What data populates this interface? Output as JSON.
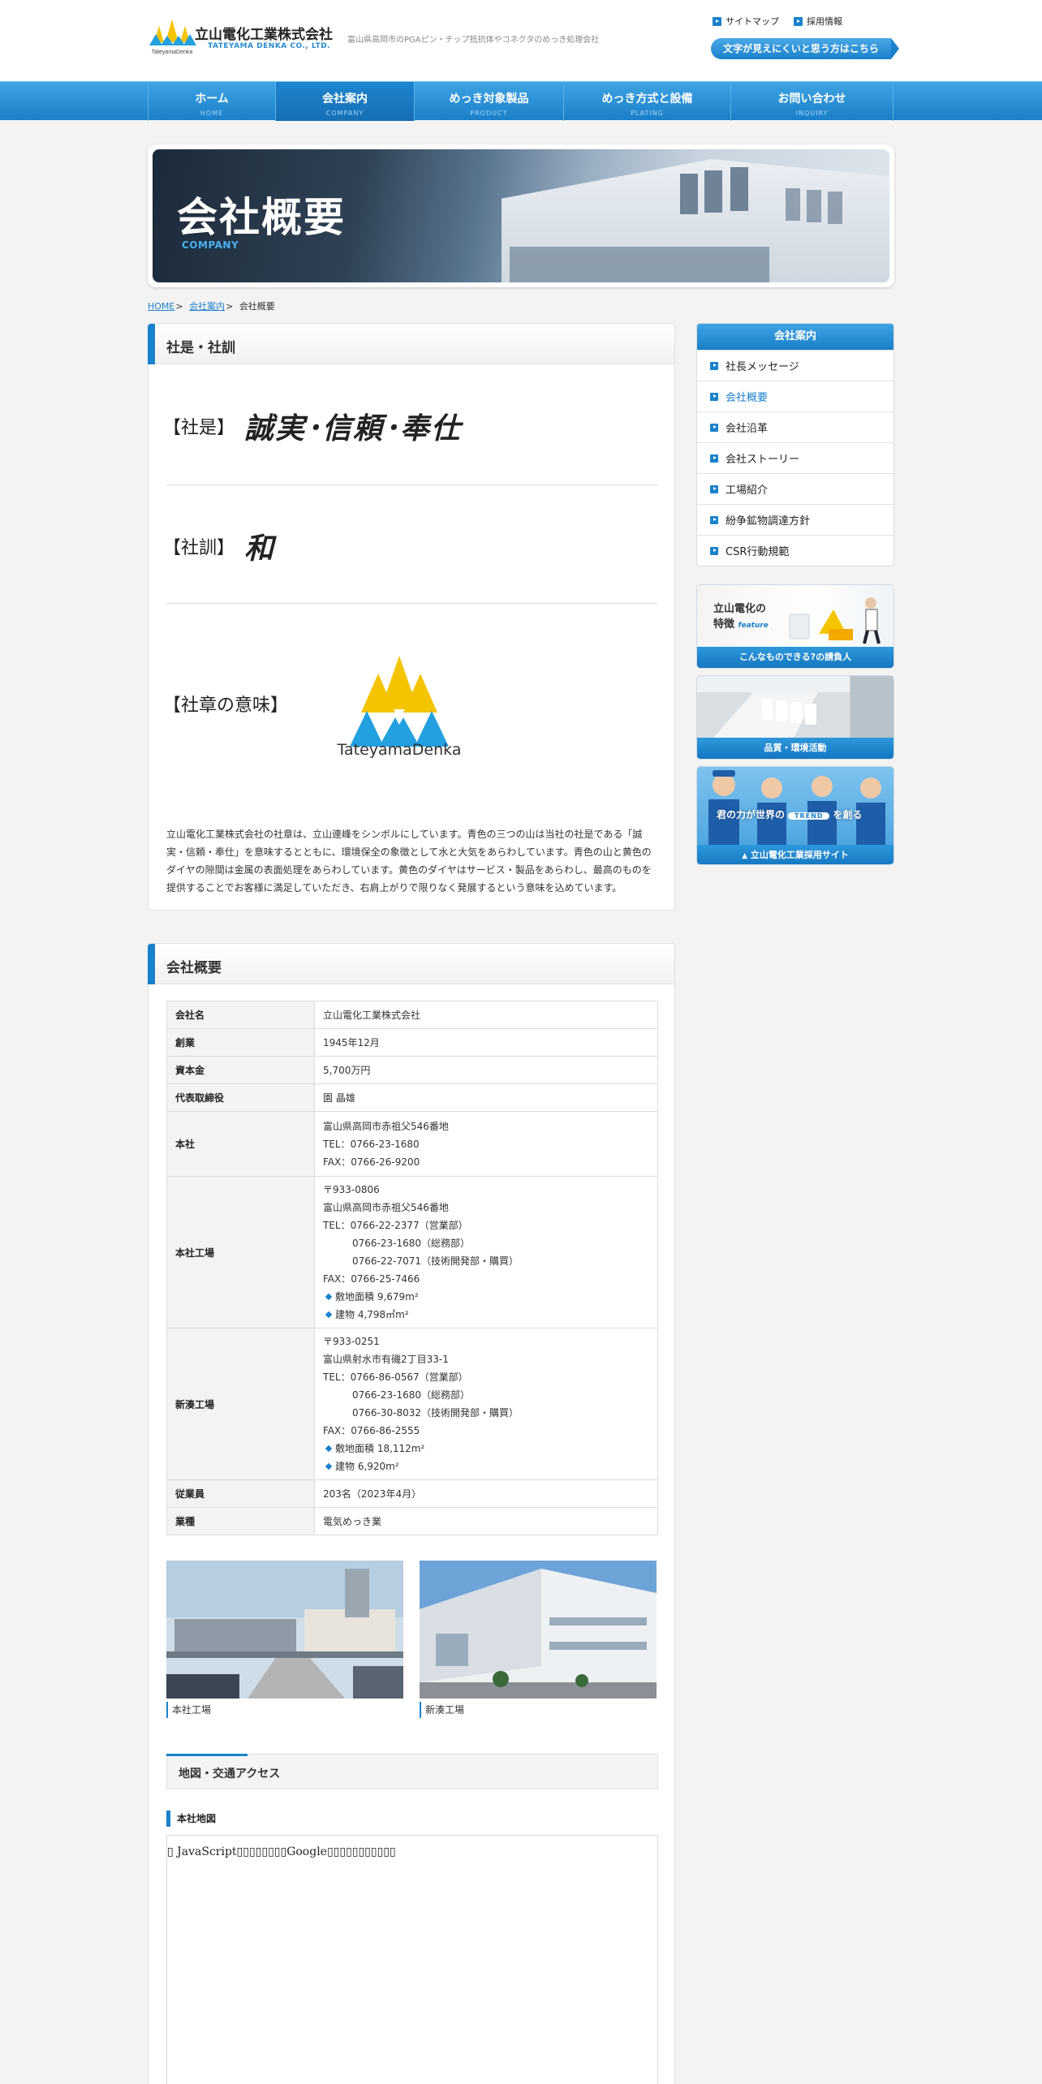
{
  "header": {
    "company_name": "立山電化工業株式会社",
    "company_name_en": "TATEYAMA DENKA CO., LTD.",
    "logo_text": "TateyamaDenka",
    "tagline": "富山県高岡市のPGAピン・チップ抵抗体やコネクタのめっき処理会社",
    "sitemap_label": "サイトマップ",
    "recruit_label": "採用情報",
    "access_label": "文字が見えにくいと思う方はこちら"
  },
  "nav": {
    "items": [
      {
        "jp": "ホーム",
        "en": "HOME"
      },
      {
        "jp": "会社案内",
        "en": "COMPANY"
      },
      {
        "jp": "めっき対象製品",
        "en": "PRODUCT"
      },
      {
        "jp": "めっき方式と設備",
        "en": "PLATING"
      },
      {
        "jp": "お問い合わせ",
        "en": "INQUIRY"
      }
    ]
  },
  "hero": {
    "title": "会社概要",
    "subtitle": "COMPANY"
  },
  "breadcrumb": {
    "home": "HOME",
    "company": "会社案内",
    "current": "会社概要"
  },
  "motto": {
    "heading": "社是・社訓",
    "shaze_label": "【社是】",
    "shaze_value": "誠実･信頼･奉仕",
    "shakun_label": "【社訓】",
    "shakun_value": "和",
    "emblem_label": "【社章の意味】",
    "emblem_caption": "TateyamaDenka",
    "description": "立山電化工業株式会社の社章は、立山連峰をシンボルにしています。青色の三つの山は当社の社是である「誠実・信頼・奉仕」を意味するとともに、環境保全の象徴として水と大気をあらわしています。青色の山と黄色のダイヤの隙間は金属の表面処理をあらわしています。黄色のダイヤはサービス・製品をあらわし、最高のものを提供することでお客様に満足していただき、右肩上がりで限りなく発展するという意味を込めています。"
  },
  "overview": {
    "heading": "会社概要",
    "rows": {
      "name": {
        "label": "会社名",
        "value": "立山電化工業株式会社"
      },
      "founded": {
        "label": "創業",
        "value": "1945年12月"
      },
      "capital": {
        "label": "資本金",
        "value": "5,700万円"
      },
      "ceo": {
        "label": "代表取締役",
        "value": "園 晶雄"
      },
      "hq": {
        "label": "本社",
        "address": "富山県高岡市赤祖父546番地",
        "tel": "TEL：0766-23-1680",
        "fax": "FAX：0766-26-9200"
      },
      "honsha_factory": {
        "label": "本社工場",
        "zip": "〒933-0806",
        "address": "富山県高岡市赤祖父546番地",
        "tel1": "TEL：0766-22-2377（営業部）",
        "tel2": "0766-23-1680（総務部）",
        "tel3": "0766-22-7071（技術開発部・購買）",
        "fax": "FAX：0766-25-7466",
        "site_area": "敷地面積 9,679m²",
        "building": "建物 4,798㎡m²"
      },
      "shinminato_factory": {
        "label": "新湊工場",
        "zip": "〒933-0251",
        "address": "富山県射水市有磯2丁目33-1",
        "tel1": "TEL：0766-86-0567（営業部）",
        "tel2": "0766-23-1680（総務部）",
        "tel3": "0766-30-8032（技術開発部・購買）",
        "fax": "FAX：0766-86-2555",
        "site_area": "敷地面積 18,112m²",
        "building": "建物 6,920m²"
      },
      "employees": {
        "label": "従業員",
        "value": "203名（2023年4月）"
      },
      "business": {
        "label": "業種",
        "value": "電気めっき業"
      }
    },
    "photo1_caption": "本社工場",
    "photo2_caption": "新湊工場",
    "access_heading": "地図・交通アクセス",
    "map_heading": "本社地図",
    "map_note": "▯ JavaScript▯▯▯▯▯▯▯▯Google▯▯▯▯▯▯▯▯▯▯▯"
  },
  "sidebar": {
    "heading": "会社案内",
    "items": [
      "社長メッセージ",
      "会社概要",
      "会社沿革",
      "会社ストーリー",
      "工場紹介",
      "紛争鉱物調達方針",
      "CSR行動規範"
    ],
    "active_index": 1
  },
  "banners": {
    "feature_title_1": "立山電化の",
    "feature_title_2": "特徴",
    "feature_tag": "feature",
    "feature_bar": "こんなものできる?の請負人",
    "quality_bar": "品質・環境活動",
    "recruit_text_1": "君の力が世界の",
    "recruit_trend": "TREND",
    "recruit_text_2": "を創る",
    "recruit_bar": "立山電化工業採用サイト"
  },
  "colors": {
    "brand_blue": "#1a82cc",
    "logo_yellow": "#f5c400",
    "logo_blue": "#22a0e0"
  }
}
